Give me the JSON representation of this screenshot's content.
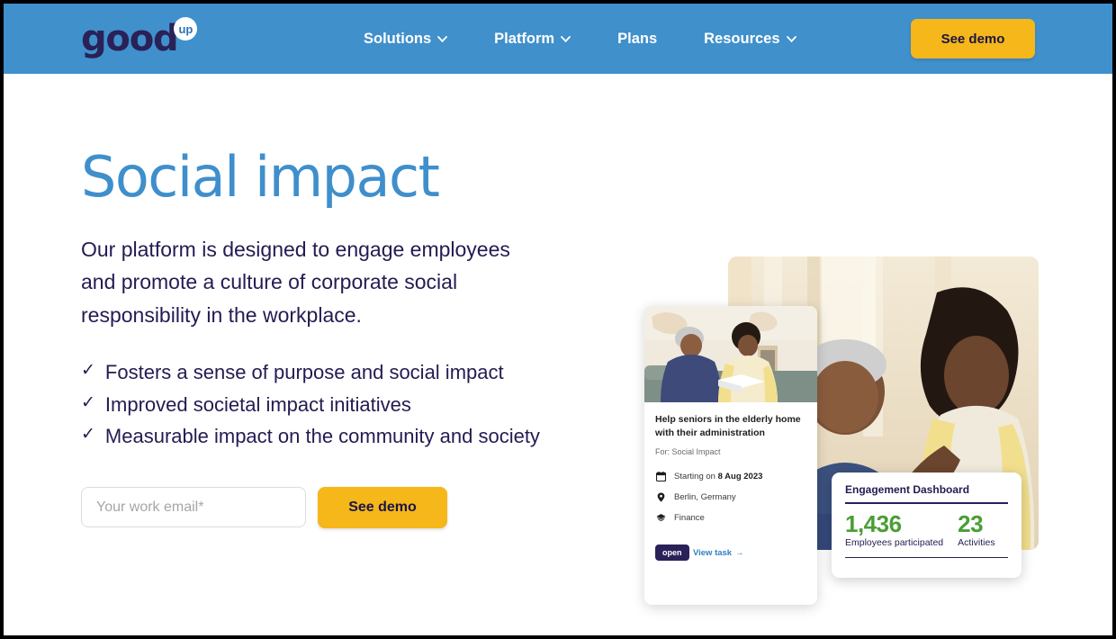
{
  "brand": {
    "logo_word": "good",
    "logo_badge": "up",
    "header_bg": "#4090cc",
    "accent_yellow": "#f5b719",
    "navy": "#221c52",
    "blue": "#3f8fcc",
    "green": "#4a9e35"
  },
  "nav": {
    "items": [
      {
        "label": "Solutions",
        "has_chevron": true,
        "icon": "chevron-down-icon"
      },
      {
        "label": "Platform",
        "has_chevron": true,
        "icon": "chevron-down-icon"
      },
      {
        "label": "Plans",
        "has_chevron": false,
        "icon": ""
      },
      {
        "label": "Resources",
        "has_chevron": true,
        "icon": "chevron-down-icon"
      }
    ],
    "cta_label": "See demo"
  },
  "hero": {
    "title": "Social impact",
    "subtitle": "Our platform is designed to engage employees and promote a culture of corporate social responsibility in the workplace.",
    "check_glyph": "✓",
    "bullets": [
      "Fosters a sense of purpose and social impact",
      "Improved societal impact initiatives",
      "Measurable impact on the community and society"
    ],
    "form": {
      "email_placeholder": "Your work email*",
      "email_value": "",
      "submit_label": "See demo"
    }
  },
  "task_card": {
    "title": "Help seniors in the elderly home with their administration",
    "for_label": "For: Social Impact",
    "meta": [
      {
        "icon": "calendar-icon",
        "prefix": "Starting on ",
        "value": "8 Aug 2023"
      },
      {
        "icon": "location-pin-icon",
        "prefix": "",
        "value": "Berlin, Germany"
      },
      {
        "icon": "graduation-cap-icon",
        "prefix": "",
        "value": "Finance"
      }
    ],
    "status_badge": "open",
    "link_label": "View task",
    "link_arrow": "→"
  },
  "dashboard_card": {
    "title": "Engagement Dashboard",
    "stats": [
      {
        "value": "1,436",
        "label": "Employees participated"
      },
      {
        "value": "23",
        "label": "Activities"
      }
    ]
  }
}
